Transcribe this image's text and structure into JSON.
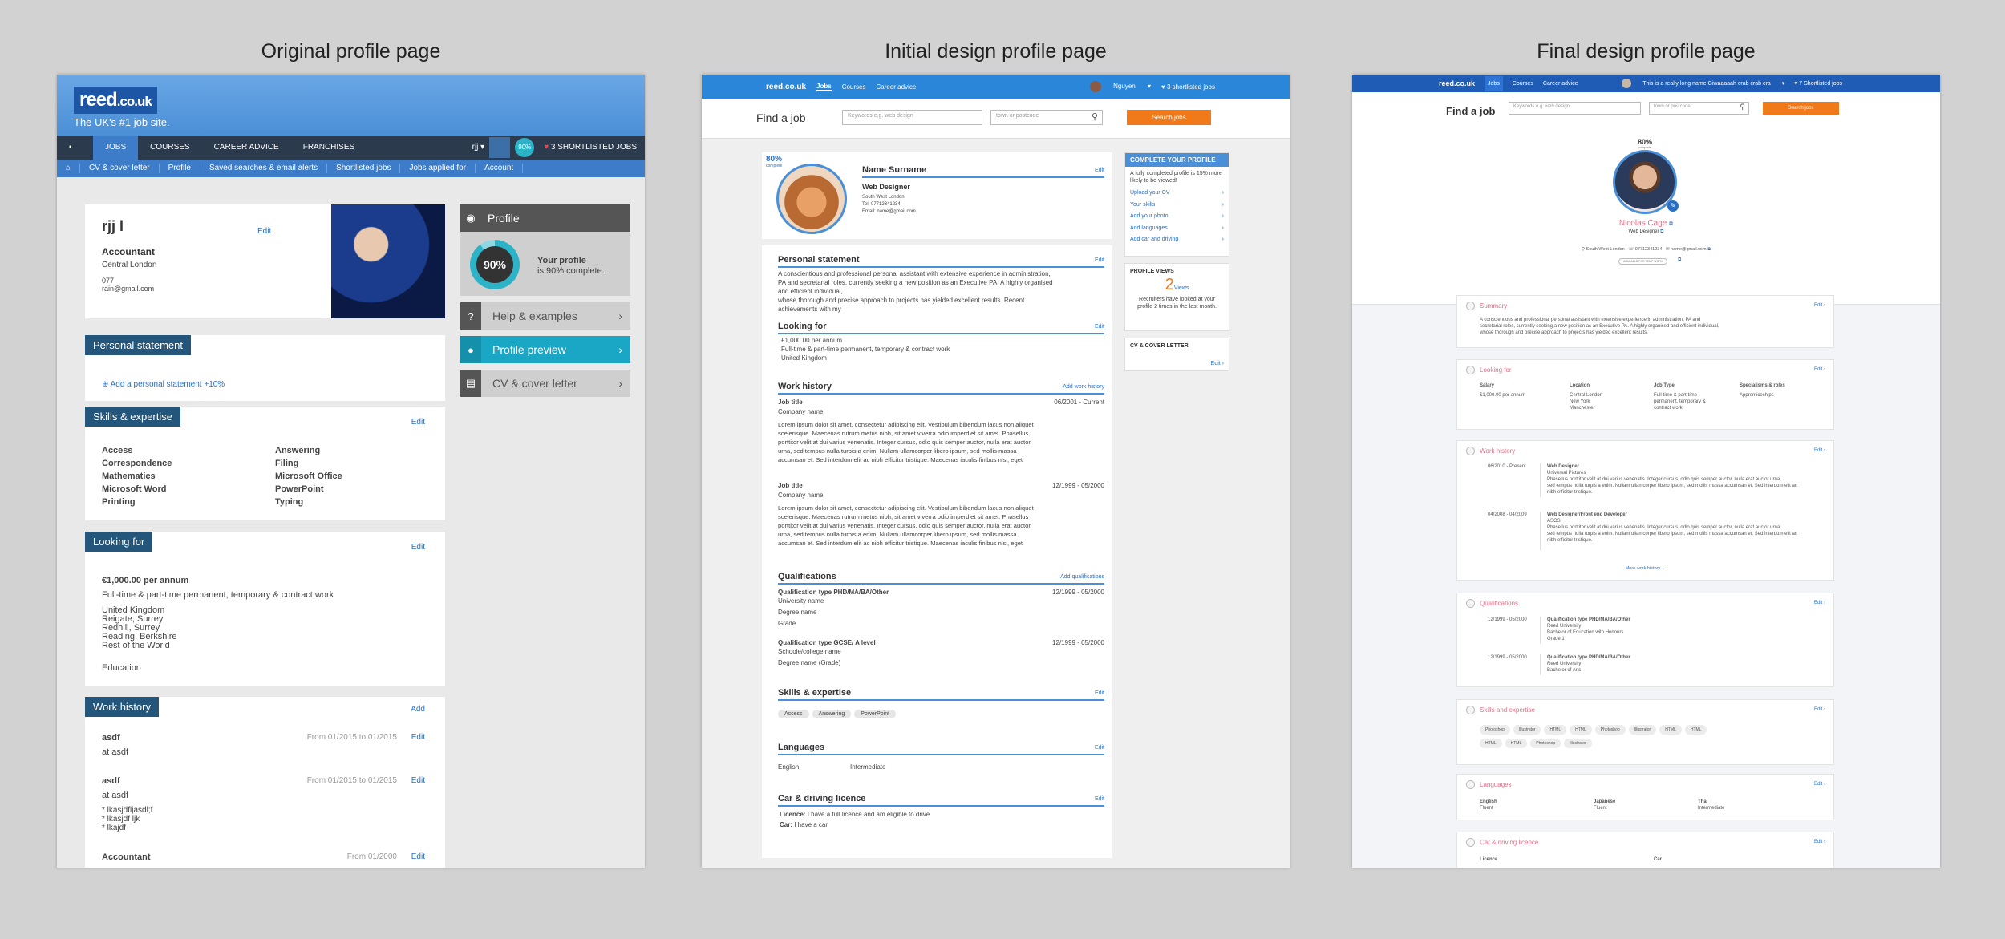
{
  "captions": {
    "p1": "Original profile page",
    "p2": "Initial design profile page",
    "p3": "Final design profile page"
  },
  "p1": {
    "logo": "reed",
    "logo_suffix": ".co.uk",
    "tagline": "The UK's #1 job site.",
    "nav": {
      "jobs": "JOBS",
      "courses": "COURSES",
      "career": "CAREER ADVICE",
      "franchises": "FRANCHISES",
      "user": "rjj",
      "percent": "90%",
      "shortlisted": "3 SHORTLISTED JOBS"
    },
    "sub": [
      "CV & cover letter",
      "Profile",
      "Saved searches & email alerts",
      "Shortlisted jobs",
      "Jobs applied for",
      "Account"
    ],
    "name": "rjj l",
    "edit": "Edit",
    "title": "Accountant",
    "location": "Central London",
    "phone": "077",
    "email": "rain@gmail.com",
    "side": {
      "profile": "Profile",
      "percent": "90%",
      "complete1": "Your profile",
      "complete2": "is 90% complete.",
      "help": "Help & examples",
      "preview": "Profile preview",
      "cv": "CV & cover letter"
    },
    "personal": {
      "title": "Personal statement",
      "add": "Add a personal statement +10%"
    },
    "skills": {
      "title": "Skills & expertise",
      "edit": "Edit",
      "col1": [
        "Access",
        "Correspondence",
        "Mathematics",
        "Microsoft Word",
        "Printing"
      ],
      "col2": [
        "Answering",
        "Filing",
        "Microsoft Office",
        "PowerPoint",
        "Typing"
      ]
    },
    "looking": {
      "title": "Looking for",
      "edit": "Edit",
      "salary": "€1,000.00 per annum",
      "type": "Full-time & part-time permanent, temporary & contract work",
      "places": [
        "United Kingdom",
        "Reigate, Surrey",
        "Redhill, Surrey",
        "Reading, Berkshire",
        "Rest of the World"
      ],
      "edu": "Education"
    },
    "work": {
      "title": "Work history",
      "add": "Add",
      "jobs": [
        {
          "t": "asdf",
          "at": "at asdf",
          "d": "From 01/2015 to 01/2015"
        },
        {
          "t": "asdf",
          "at": "at asdf",
          "d": "From 01/2015 to 01/2015",
          "bul": [
            "* lkasjdfljasdl;f",
            "* lkasjdf ljk",
            "* lkajdf"
          ]
        },
        {
          "t": "Accountant",
          "d": "From 01/2000"
        }
      ]
    }
  },
  "p2": {
    "nav": {
      "logo": "reed.co.uk",
      "jobs": "Jobs",
      "courses": "Courses",
      "career": "Career advice",
      "user": "Nguyen",
      "shortlisted": "3 shortlisted jobs"
    },
    "find": "Find a job",
    "kw": "Keywords e.g. web design",
    "loc": "town or postcode",
    "search": "Search jobs",
    "percent": "80%",
    "complete": "complete",
    "name": "Name Surname",
    "edit": "Edit",
    "role": "Web Designer",
    "loc1": "South West London",
    "tel": "Tel: 07712341234",
    "email": "Email: name@gmail.com",
    "cp": {
      "title": "COMPLETE YOUR PROFILE",
      "intro": "A fully completed profile is 15% more likely to be viewed!",
      "items": [
        "Upload your CV",
        "Your skills",
        "Add your photo",
        "Add languages",
        "Add car and driving"
      ]
    },
    "views": {
      "title": "PROFILE VIEWS",
      "num": "2",
      "unit": "Views",
      "text": "Recruiters have looked at your profile 2 times in the last month."
    },
    "cvc": {
      "title": "CV & COVER LETTER",
      "edit": "Edit"
    },
    "ps": {
      "title": "Personal statement",
      "edit": "Edit",
      "text": [
        "A conscientious and professional personal assistant with extensive experience in administration,",
        "PA and secretarial roles, currently seeking a new position as an Executive PA. A highly organised",
        "and efficient individual,",
        "whose thorough and precise approach to projects has yielded excellent results. Recent",
        "achievements with my"
      ]
    },
    "lf": {
      "title": "Looking for",
      "edit": "Edit",
      "lines": [
        "£1,000.00 per annum",
        "Full-time & part-time permanent, temporary & contract work",
        "United Kingdom"
      ]
    },
    "wh": {
      "title": "Work history",
      "add": "Add work history",
      "jobs": [
        {
          "t": "Job title",
          "c": "Company name",
          "d": "06/2001 - Current"
        },
        {
          "t": "Job title",
          "c": "Company name",
          "d": "12/1999 - 05/2000"
        }
      ],
      "lorem": [
        "Lorem ipsum dolor sit amet, consectetur adipiscing elit. Vestibulum bibendum lacus non aliquet",
        "scelerisque. Maecenas rutrum metus nibh, sit amet viverra odio imperdiet sit amet. Phasellus",
        "porttitor velit at dui varius venenatis. Integer cursus, odio quis semper auctor, nulla erat auctor",
        "urna, sed tempus nulla turpis a enim. Nullam ullamcorper libero ipsum, sed mollis massa",
        "accumsan et. Sed interdum elit ac nibh efficitur tristique. Maecenas iaculis finibus nisi, eget"
      ]
    },
    "q": {
      "title": "Qualifications",
      "add": "Add qualifications",
      "items": [
        {
          "t": "Qualification type PHD/MA/BA/Other",
          "l1": "University name",
          "l2": "Degree name",
          "l3": "Grade",
          "d": "12/1999 - 05/2000"
        },
        {
          "t": "Qualification type GCSE/ A level",
          "l1": "Schoole/college name",
          "l2": "Degree name (Grade)",
          "d": "12/1999 - 05/2000"
        }
      ]
    },
    "sk": {
      "title": "Skills & expertise",
      "edit": "Edit",
      "chips": [
        "Access",
        "Answering",
        "PowerPoint"
      ]
    },
    "lang": {
      "title": "Languages",
      "edit": "Edit",
      "name": "English",
      "level": "Intermediate"
    },
    "car": {
      "title": "Car & driving licence",
      "edit": "Edit",
      "l1a": "Licence:",
      "l1b": " I have a full licence and am eligible to drive",
      "l2a": "Car:",
      "l2b": " I have a car"
    }
  },
  "p3": {
    "nav": {
      "logo": "reed.co.uk",
      "jobs": "Jobs",
      "courses": "Courses",
      "career": "Career advice",
      "user": "This is a really long name Giwaaaaah crab crab cra",
      "shortlisted": "7 Shortlisted jobs"
    },
    "find": "Find a job",
    "kw": "Keywords e.g. web design",
    "loc": "town or postcode",
    "search": "Search jobs",
    "percent": "80%",
    "complete": "complete",
    "name": "Nicolas Cage",
    "role": "Web Designer",
    "loc1": "South West London",
    "tel": "07712341234",
    "email": "name@gmail.com",
    "avail": "AVAILABLE FOR TEMP WORK",
    "summary": {
      "title": "Summary",
      "edit": "Edit",
      "text": [
        "A conscientious and professional personal assistant with extensive experience in administration, PA and",
        "secretarial roles, currently seeking a new position as an Executive PA. A highly organised and efficient individual,",
        "whose thorough and precise approach to projects has yielded excellent results."
      ]
    },
    "looking": {
      "title": "Looking for",
      "edit": "Edit",
      "h": [
        "Salary",
        "Location",
        "Job Type",
        "Specialisms & roles"
      ],
      "c1": "£1,000.00 per annum",
      "c2": [
        "Central London",
        "New York",
        "Manchester"
      ],
      "c3": [
        "Full-time & part-time",
        "permanent, temporary &",
        "contract work"
      ],
      "c4": "Apprenticeships"
    },
    "work": {
      "title": "Work history",
      "edit": "Edit",
      "more": "More work history",
      "jobs": [
        {
          "d": "06/2010 - Present",
          "t": "Web Designer",
          "c": "Universal Pictures"
        },
        {
          "d": "04/2008 - 04/2009",
          "t": "Web Designer/Front end Developer",
          "c": "ASOS"
        }
      ],
      "lorem": [
        "Phasellus porttitor velit at dui varius venenatis. Integer cursus, odio quis semper auctor, nulla erat auctor urna,",
        "sed tempus nulla turpis a enim. Nullam ullamcorper libero ipsum, sed mollis massa accumsan et. Sed interdum elit ac",
        "nibh efficitur tristique."
      ]
    },
    "qual": {
      "title": "Qualifications",
      "edit": "Edit",
      "items": [
        {
          "d": "12/1999 - 05/2000",
          "t": "Qualification type PHD/MA/BA/Other",
          "u": "Reed University",
          "g": "Bachelor of Education with Honours",
          "gr": "Grade 1"
        },
        {
          "d": "12/1999 - 05/2000",
          "t": "Qualification type PHD/MA/BA/Other",
          "u": "Reed University",
          "g": "Bachelor of Arts"
        }
      ]
    },
    "skills": {
      "title": "Skills and expertise",
      "edit": "Edit",
      "chips": [
        "Photoshop",
        "Illustrator",
        "HTML",
        "HTML",
        "Photoshop",
        "Illustrator",
        "HTML",
        "HTML",
        "HTML",
        "HTML",
        "Photoshop",
        "Illustrator"
      ]
    },
    "lang": {
      "title": "Languages",
      "edit": "Edit",
      "items": [
        {
          "n": "English",
          "l": "Fluent"
        },
        {
          "n": "Japanese",
          "l": "Fluent"
        },
        {
          "n": "Thai",
          "l": "Intermediate"
        }
      ]
    },
    "car": {
      "title": "Car & driving licence",
      "edit": "Edit",
      "h1": "Licence",
      "h2": "Car"
    }
  }
}
